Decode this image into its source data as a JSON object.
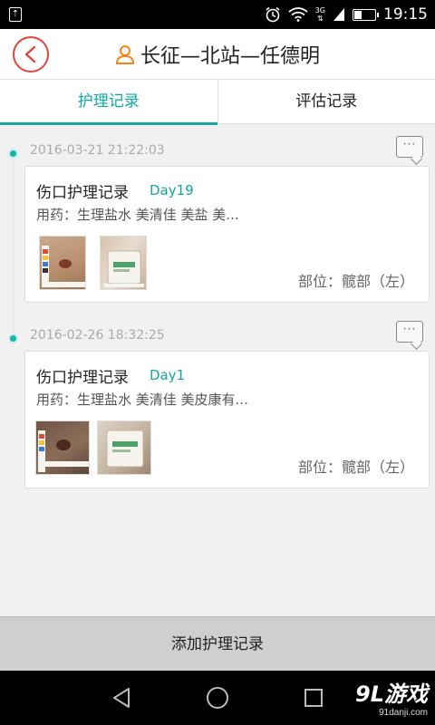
{
  "status_bar": {
    "time": "19:15",
    "network": "3G",
    "battery_level": 0.35,
    "usb_symbol": "⇡"
  },
  "header": {
    "title": "长征—北站—任德明",
    "icons": {
      "back": "chevron-left-icon",
      "person": "person-icon"
    },
    "accent_color": "#e0443c"
  },
  "tabs": [
    {
      "label": "护理记录",
      "active": true
    },
    {
      "label": "评估记录",
      "active": false
    }
  ],
  "accent_color": "#12a9a0",
  "records": [
    {
      "datetime": "2016-03-21 21:22:03",
      "comment_glyph": "···",
      "title": "伤口护理记录",
      "day": "Day19",
      "medication": "用药：生理盐水 美清佳 美盐 美...",
      "location": "部位：髋部（左）"
    },
    {
      "datetime": "2016-02-26 18:32:25",
      "comment_glyph": "···",
      "title": "伤口护理记录",
      "day": "Day1",
      "medication": "用药：生理盐水 美清佳 美皮康有...",
      "location": "部位：髋部（左）"
    }
  ],
  "add_button": {
    "label": "添加护理记录"
  },
  "watermark": {
    "main": "9L游戏",
    "sub": "91danji.com"
  }
}
